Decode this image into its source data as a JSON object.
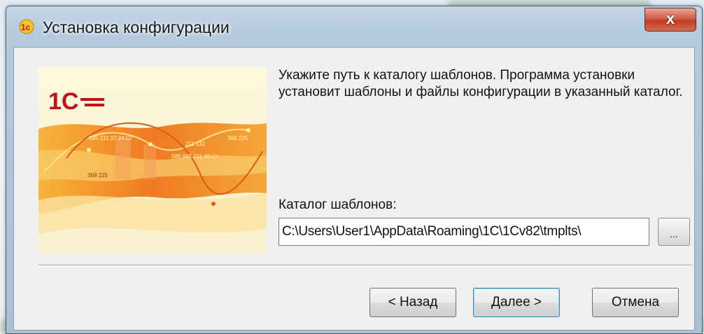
{
  "window": {
    "title": "Установка конфигурации",
    "close_symbol": "x"
  },
  "content": {
    "description": "Укажите путь к каталогу шаблонов. Программа установки установит шаблоны и файлы конфигурации в указанный каталог.",
    "catalog_label": "Каталог шаблонов:",
    "catalog_path": "C:\\Users\\User1\\AppData\\Roaming\\1C\\1Cv82\\tmplts\\",
    "browse_label": "..."
  },
  "banner": {
    "logo_text": "1С",
    "number_labels": [
      "645 211 37 24 Ст",
      "211 132",
      "368 225",
      "589 645 711 40 Ст",
      "368 225"
    ]
  },
  "buttons": {
    "back": "< Назад",
    "next": "Далее >",
    "cancel": "Отмена"
  },
  "colors": {
    "accent_red": "#c0141c",
    "banner_orange": "#f18a2a",
    "close_red": "#c23b22"
  }
}
